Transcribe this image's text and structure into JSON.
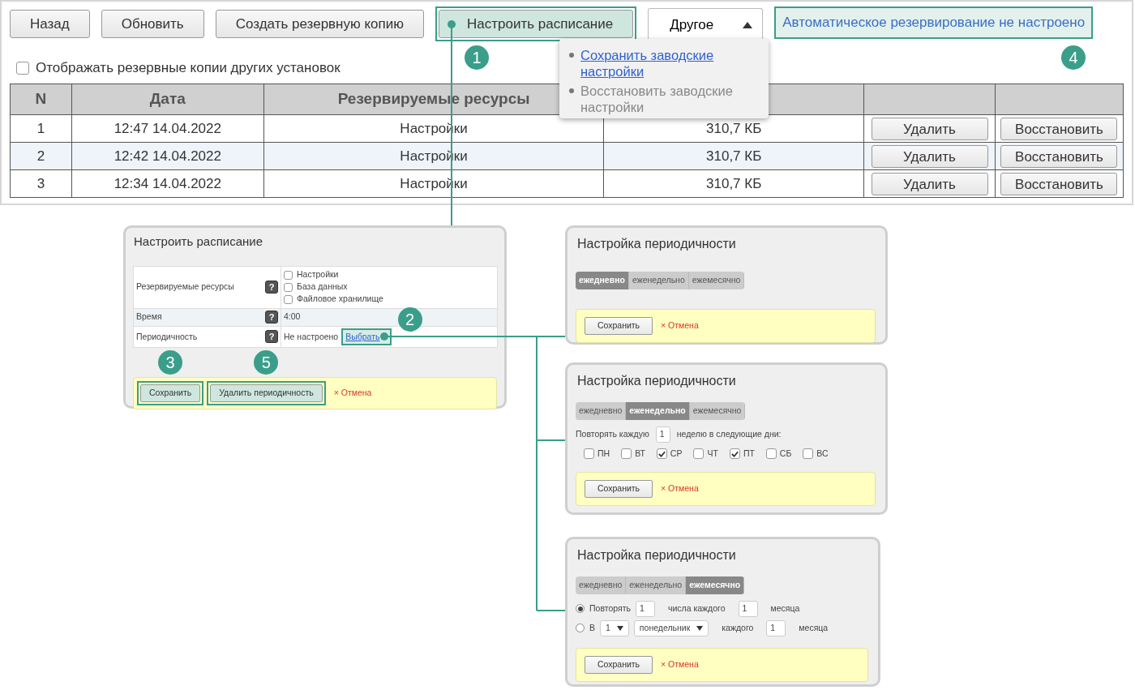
{
  "toolbar": {
    "buttons": [
      {
        "label": "Назад",
        "highlighted": false
      },
      {
        "label": "Обновить",
        "highlighted": false
      },
      {
        "label": "Создать резервную копию",
        "highlighted": false
      },
      {
        "label": "Настроить расписание",
        "highlighted": true
      }
    ],
    "menu": {
      "label": "Другое",
      "expanded": true,
      "items": [
        {
          "label": "Сохранить заводские настройки",
          "disabled": false
        },
        {
          "label": "Восстановить заводские настройки",
          "disabled": true
        }
      ]
    },
    "status": {
      "text": "Автоматическое резервирование не настроено",
      "highlighted": true
    }
  },
  "show_others": {
    "label": "Отображать резервные копии других установок",
    "checked": false
  },
  "table": {
    "columns": [
      "N",
      "Дата",
      "Резервируемые ресурсы"
    ],
    "rows": [
      {
        "n": "1",
        "date": "12:47 14.04.2022",
        "resources": "Настройки",
        "size": "310,7 КБ",
        "delete": "Удалить",
        "restore": "Восстановить",
        "selected": false
      },
      {
        "n": "2",
        "date": "12:42 14.04.2022",
        "resources": "Настройки",
        "size": "310,7 КБ",
        "delete": "Удалить",
        "restore": "Восстановить",
        "selected": true
      },
      {
        "n": "3",
        "date": "12:34 14.04.2022",
        "resources": "Настройки",
        "size": "310,7 КБ",
        "delete": "Удалить",
        "restore": "Восстановить",
        "selected": false
      }
    ]
  },
  "schedule_dialog": {
    "title": "Настроить расписание",
    "rows": [
      {
        "kind": "checklist",
        "label": "Резервируемые ресурсы",
        "help": "?",
        "options": [
          {
            "label": "Настройки",
            "checked": false
          },
          {
            "label": "База данных",
            "checked": false
          },
          {
            "label": "Файловое хранилище",
            "checked": false
          }
        ]
      },
      {
        "kind": "text",
        "label": "Время",
        "help": "?",
        "value": "4:00"
      },
      {
        "kind": "link",
        "label": "Периодичность",
        "help": "?",
        "value": "Не настроено",
        "link": "Выбрать",
        "highlighted": true
      }
    ],
    "buttons": [
      {
        "label": "Сохранить",
        "highlighted": true
      },
      {
        "label": "Удалить периодичность",
        "highlighted": true
      }
    ],
    "cancel": "× Отмена"
  },
  "periodicity_dialogs": [
    {
      "kind": "daily",
      "title": "Настройка периодичности",
      "tabs": [
        {
          "label": "ежедневно",
          "selected": true
        },
        {
          "label": "еженедельно",
          "selected": false
        },
        {
          "label": "ежемесячно",
          "selected": false
        }
      ],
      "save": "Сохранить",
      "cancel": "× Отмена"
    },
    {
      "kind": "weekly",
      "title": "Настройка периодичности",
      "tabs": [
        {
          "label": "ежедневно",
          "selected": false
        },
        {
          "label": "еженедельно",
          "selected": true
        },
        {
          "label": "ежемесячно",
          "selected": false
        }
      ],
      "repeat_prefix": "Повторять каждую",
      "repeat_value": "1",
      "repeat_suffix": "неделю в следующие дни:",
      "days": [
        {
          "label": "ПН",
          "checked": false
        },
        {
          "label": "ВТ",
          "checked": false
        },
        {
          "label": "СР",
          "checked": true
        },
        {
          "label": "ЧТ",
          "checked": false
        },
        {
          "label": "ПТ",
          "checked": true
        },
        {
          "label": "СБ",
          "checked": false
        },
        {
          "label": "ВС",
          "checked": false
        }
      ],
      "save": "Сохранить",
      "cancel": "× Отмена"
    },
    {
      "kind": "monthly",
      "title": "Настройка периодичности",
      "tabs": [
        {
          "label": "ежедневно",
          "selected": false
        },
        {
          "label": "еженедельно",
          "selected": false
        },
        {
          "label": "ежемесячно",
          "selected": true
        }
      ],
      "options": [
        {
          "selected": true,
          "items": [
            {
              "kind": "label",
              "text": "Повторять"
            },
            {
              "kind": "input",
              "value": "1"
            },
            {
              "kind": "text",
              "text": "числа каждого"
            },
            {
              "kind": "input",
              "value": "1"
            },
            {
              "kind": "text",
              "text": "месяца"
            }
          ]
        },
        {
          "selected": false,
          "items": [
            {
              "kind": "label",
              "text": "В"
            },
            {
              "kind": "select",
              "value": "1"
            },
            {
              "kind": "select",
              "value": "понедельник"
            },
            {
              "kind": "text",
              "text": "каждого"
            },
            {
              "kind": "input",
              "value": "1"
            },
            {
              "kind": "text",
              "text": "месяца"
            }
          ]
        }
      ],
      "save": "Сохранить",
      "cancel": "× Отмена"
    }
  ],
  "callouts": [
    {
      "number": "1"
    },
    {
      "number": "2"
    },
    {
      "number": "3"
    },
    {
      "number": "4"
    },
    {
      "number": "5"
    }
  ]
}
